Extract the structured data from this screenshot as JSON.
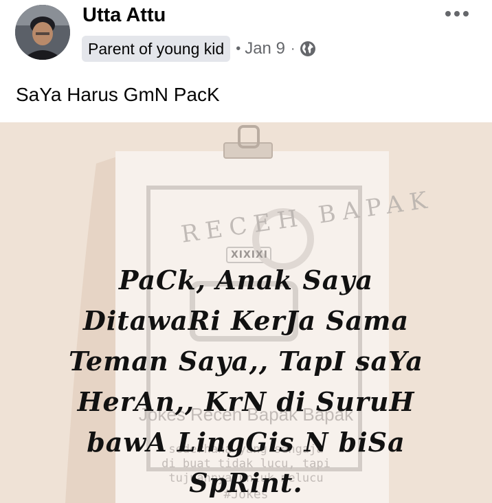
{
  "post": {
    "author": "Utta Attu",
    "badge": "Parent of young kid",
    "separator": "•",
    "date": "Jan 9",
    "separator2": "·",
    "privacy_icon": "globe-icon",
    "more_icon": "more-options-icon",
    "text": "SaYa Harus GmN PacK"
  },
  "image": {
    "watermark_arc": "RECEH BAPAK",
    "watermark_badge": "XIXIXI",
    "watermark_caption": "Jokes Receh Bapak Bapak",
    "watermark_line1": "sederhana yang sengaja",
    "watermark_line2": "di buat tidak lucu, tapi",
    "watermark_line3": "tujuannya untuk melucu",
    "watermark_tag": "#Jokes",
    "meme_lines": [
      "PaCk, Anak Saya",
      "DitawaRi KerJa Sama",
      "Teman Saya,, TapI saYa",
      "HerAn,, KrN di SuruH",
      "bawA LingGis N biSa",
      "SpRint."
    ]
  },
  "colors": {
    "background": "#efe2d6",
    "paper": "#f7f1ec",
    "meme_text": "#111111",
    "secondary_text": "#65676b"
  }
}
